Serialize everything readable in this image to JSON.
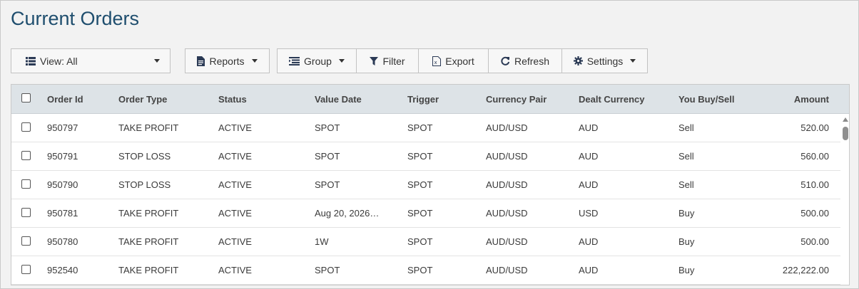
{
  "page": {
    "title": "Current Orders"
  },
  "toolbar": {
    "view_label": "View: All",
    "reports_label": "Reports",
    "group_label": "Group",
    "filter_label": "Filter",
    "export_label": "Export",
    "refresh_label": "Refresh",
    "settings_label": "Settings"
  },
  "icons": {
    "view": "list-icon",
    "reports": "document-icon",
    "group": "group-list-icon",
    "filter": "funnel-icon",
    "export": "excel-icon",
    "refresh": "refresh-icon",
    "settings": "gear-icon"
  },
  "table": {
    "headers": {
      "order_id": "Order Id",
      "order_type": "Order Type",
      "status": "Status",
      "value_date": "Value Date",
      "trigger": "Trigger",
      "currency_pair": "Currency Pair",
      "dealt_currency": "Dealt Currency",
      "buy_sell": "You Buy/Sell",
      "amount": "Amount"
    },
    "rows": [
      {
        "order_id": "950797",
        "order_type": "TAKE PROFIT",
        "status": "ACTIVE",
        "value_date": "SPOT",
        "trigger": "SPOT",
        "currency_pair": "AUD/USD",
        "dealt_currency": "AUD",
        "buy_sell": "Sell",
        "amount": "520.00"
      },
      {
        "order_id": "950791",
        "order_type": "STOP LOSS",
        "status": "ACTIVE",
        "value_date": "SPOT",
        "trigger": "SPOT",
        "currency_pair": "AUD/USD",
        "dealt_currency": "AUD",
        "buy_sell": "Sell",
        "amount": "560.00"
      },
      {
        "order_id": "950790",
        "order_type": "STOP LOSS",
        "status": "ACTIVE",
        "value_date": "SPOT",
        "trigger": "SPOT",
        "currency_pair": "AUD/USD",
        "dealt_currency": "AUD",
        "buy_sell": "Sell",
        "amount": "510.00"
      },
      {
        "order_id": "950781",
        "order_type": "TAKE PROFIT",
        "status": "ACTIVE",
        "value_date": "Aug 20, 2026…",
        "trigger": "SPOT",
        "currency_pair": "AUD/USD",
        "dealt_currency": "USD",
        "buy_sell": "Buy",
        "amount": "500.00"
      },
      {
        "order_id": "950780",
        "order_type": "TAKE PROFIT",
        "status": "ACTIVE",
        "value_date": "1W",
        "trigger": "SPOT",
        "currency_pair": "AUD/USD",
        "dealt_currency": "AUD",
        "buy_sell": "Buy",
        "amount": "500.00"
      },
      {
        "order_id": "952540",
        "order_type": "TAKE PROFIT",
        "status": "ACTIVE",
        "value_date": "SPOT",
        "trigger": "SPOT",
        "currency_pair": "AUD/USD",
        "dealt_currency": "AUD",
        "buy_sell": "Buy",
        "amount": "222,222.00"
      }
    ]
  }
}
